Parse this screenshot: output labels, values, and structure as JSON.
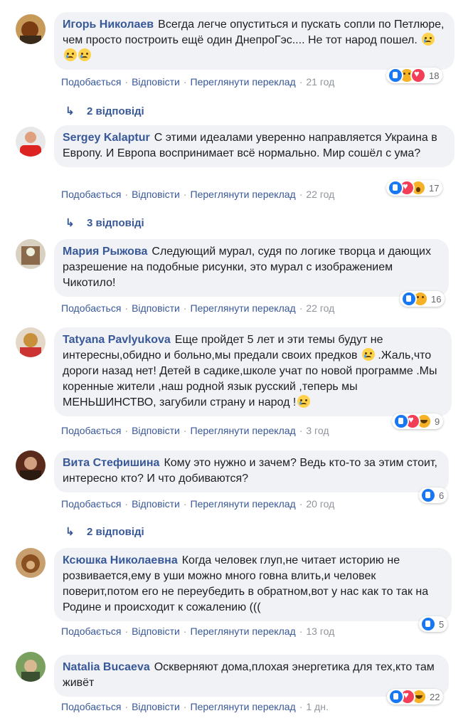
{
  "actions": {
    "like": "Подобається",
    "reply": "Відповісти",
    "translate": "Переглянути переклад"
  },
  "comments": [
    {
      "author": "Игорь Николаев",
      "text": "Всегда легче опуститься и пускать сопли по Петлюре, чем просто построить ещё один ДнепроГэс.... Не тот народ пошел.",
      "emojis": 3,
      "time": "21 год",
      "reactions": [
        "like",
        "sad",
        "love"
      ],
      "count": "18",
      "replies": "2 відповіді"
    },
    {
      "author": "Sergey Kalaptur",
      "text": "С этими идеалами уверенно направляется Украина в Европу. И Европа воспринимает всё нормально. Мир сошёл с ума?",
      "time": "22 год",
      "reactions": [
        "like",
        "love",
        "wow"
      ],
      "count": "17",
      "replies": "3 відповіді"
    },
    {
      "author": "Мария Рыжова",
      "text": "Следующий мурал, судя по логике творца и дающих разрешение на подобные рисунки, это мурал с изображением Чикотило!",
      "time": "22 год",
      "reactions": [
        "like",
        "sad"
      ],
      "count": "16"
    },
    {
      "author": "Tatyana Pavlyukova",
      "text": "Еще пройдет 5 лет и эти темы будут не интересны,обидно и больно,мы предали своих предков",
      "text2": ".Жаль,что дороги назад нет! Детей в садике,школе учат по новой программе .Мы коренные жители ,наш родной язык русский ,теперь мы МЕНЬШИНСТВО, загубили страну и народ !",
      "time": "3 год",
      "reactions": [
        "like",
        "love",
        "haha"
      ],
      "count": "9"
    },
    {
      "author": "Вита Стефишина",
      "text": "Кому это нужно и зачем? Ведь кто-то за этим стоит, интересно кто? И что добиваются?",
      "time": "20 год",
      "reactions": [
        "like"
      ],
      "count": "6",
      "replies": "2 відповіді"
    },
    {
      "author": "Ксюшка Николаевна",
      "text": "Когда человек глуп,не читает историю не розвивается,ему в уши можно много говна влить,и человек поверит,потом его не переубедить в обратном,вот у нас как то так на Родине и происходит к сожалению (((",
      "time": "13 год",
      "reactions": [
        "like"
      ],
      "count": "5"
    },
    {
      "author": "Natalia Bucaeva",
      "text": "Оскверняют дома,плохая энергетика для тех,кто там живёт",
      "time": "1 дн.",
      "reactions": [
        "like",
        "love",
        "haha"
      ],
      "count": "22"
    }
  ],
  "colors": {
    "link": "#385898",
    "bubble": "#f0f2f5",
    "like": "#1877f2",
    "love": "#f33e58",
    "emoji": "#f7b125"
  }
}
